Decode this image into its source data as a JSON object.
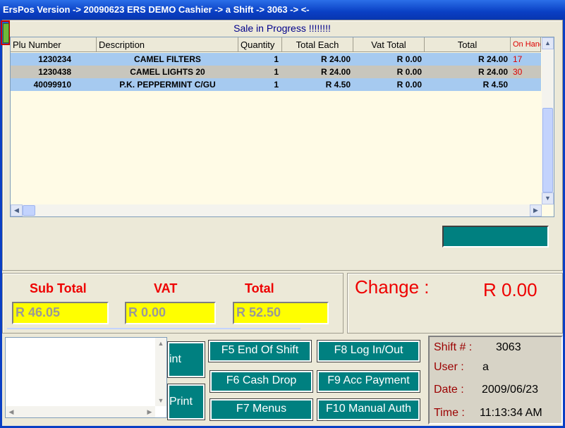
{
  "window": {
    "title": "ErsPos Version -> 20090623 ERS DEMO Cashier -> a Shift -> 3063 ->  <-"
  },
  "sale_status": "Sale in Progress !!!!!!!!",
  "grid": {
    "columns": [
      "Plu Number",
      "Description",
      "Quantity",
      "Total Each",
      "Vat Total",
      "Total",
      "On Hand"
    ],
    "rows": [
      {
        "plu": "1230234",
        "desc": "CAMEL FILTERS",
        "qty": "1",
        "each": "R 24.00",
        "vat": "R 0.00",
        "total": "R 24.00",
        "onhand": "17"
      },
      {
        "plu": "1230438",
        "desc": "CAMEL LIGHTS 20",
        "qty": "1",
        "each": "R 24.00",
        "vat": "R 0.00",
        "total": "R 24.00",
        "onhand": "30"
      },
      {
        "plu": "40099910",
        "desc": "P.K. PEPPERMINT C/GU",
        "qty": "1",
        "each": "R 4.50",
        "vat": "R 0.00",
        "total": "R 4.50",
        "onhand": ""
      }
    ]
  },
  "totals": {
    "subtotal_label": "Sub Total",
    "subtotal_value": "R  46.05",
    "vat_label": "VAT",
    "vat_value": "R  0.00",
    "total_label": "Total",
    "total_value": "R  52.50"
  },
  "change": {
    "label": "Change :",
    "value": "R 0.00"
  },
  "buttons": {
    "print_cut": "int",
    "print": "Print",
    "f5": "F5  End Of Shift",
    "f6": "F6   Cash Drop",
    "f7": "F7    Menus",
    "f8": "F8   Log In/Out",
    "f9": "F9 Acc Payment",
    "f10": "F10 Manual Auth"
  },
  "info": {
    "shift_label": "Shift  # :",
    "shift_value": "3063",
    "user_label": "User :",
    "user_value": "a",
    "date_label": "Date :",
    "date_value": "2009/06/23",
    "time_label": "Time :",
    "time_value": "11:13:34 AM"
  },
  "colors": {
    "accent": "#008080",
    "title_bar": "#0a3fc4",
    "grid_bg": "#fffbe6",
    "row_selected": "#a6caf0",
    "total_fields": "#ffff00",
    "labels_red": "#e00000"
  }
}
